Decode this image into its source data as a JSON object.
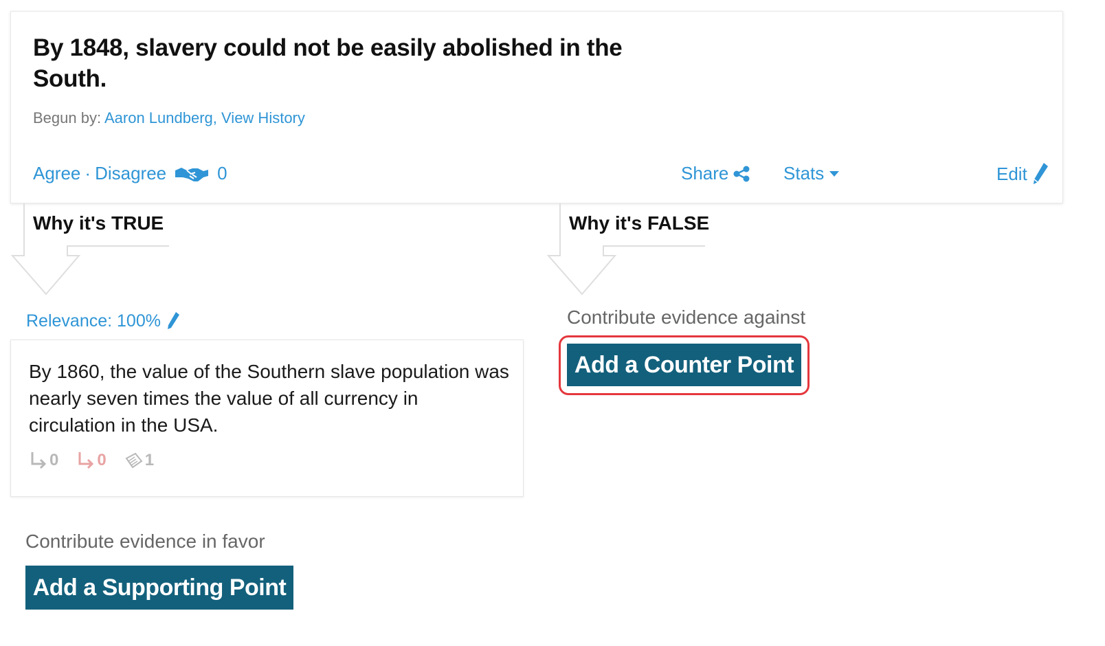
{
  "claim": {
    "title": "By 1848, slavery could not be easily abolished in the South.",
    "begun_by_label": "Begun by:",
    "author": "Aaron Lundberg",
    "separator": ",",
    "view_history": "View History",
    "agree": "Agree",
    "dot": "·",
    "disagree": "Disagree",
    "agree_count": "0",
    "share": "Share",
    "stats": "Stats",
    "edit": "Edit"
  },
  "columns": {
    "true_heading": "Why it's TRUE",
    "false_heading": "Why it's FALSE"
  },
  "supporting": {
    "relevance": "Relevance: 100%",
    "point_text": "By 1860, the value of the Southern slave population was nearly seven times the value of all currency in circulation in the USA.",
    "support_count": "0",
    "counter_count": "0",
    "source_count": "1",
    "contribute_label": "Contribute evidence in favor",
    "button_label": "Add a Supporting Point"
  },
  "counter": {
    "contribute_label": "Contribute evidence against",
    "button_label": "Add a Counter Point"
  },
  "colors": {
    "link": "#2f95d6",
    "button": "#13607c",
    "highlight": "#e4373d"
  }
}
